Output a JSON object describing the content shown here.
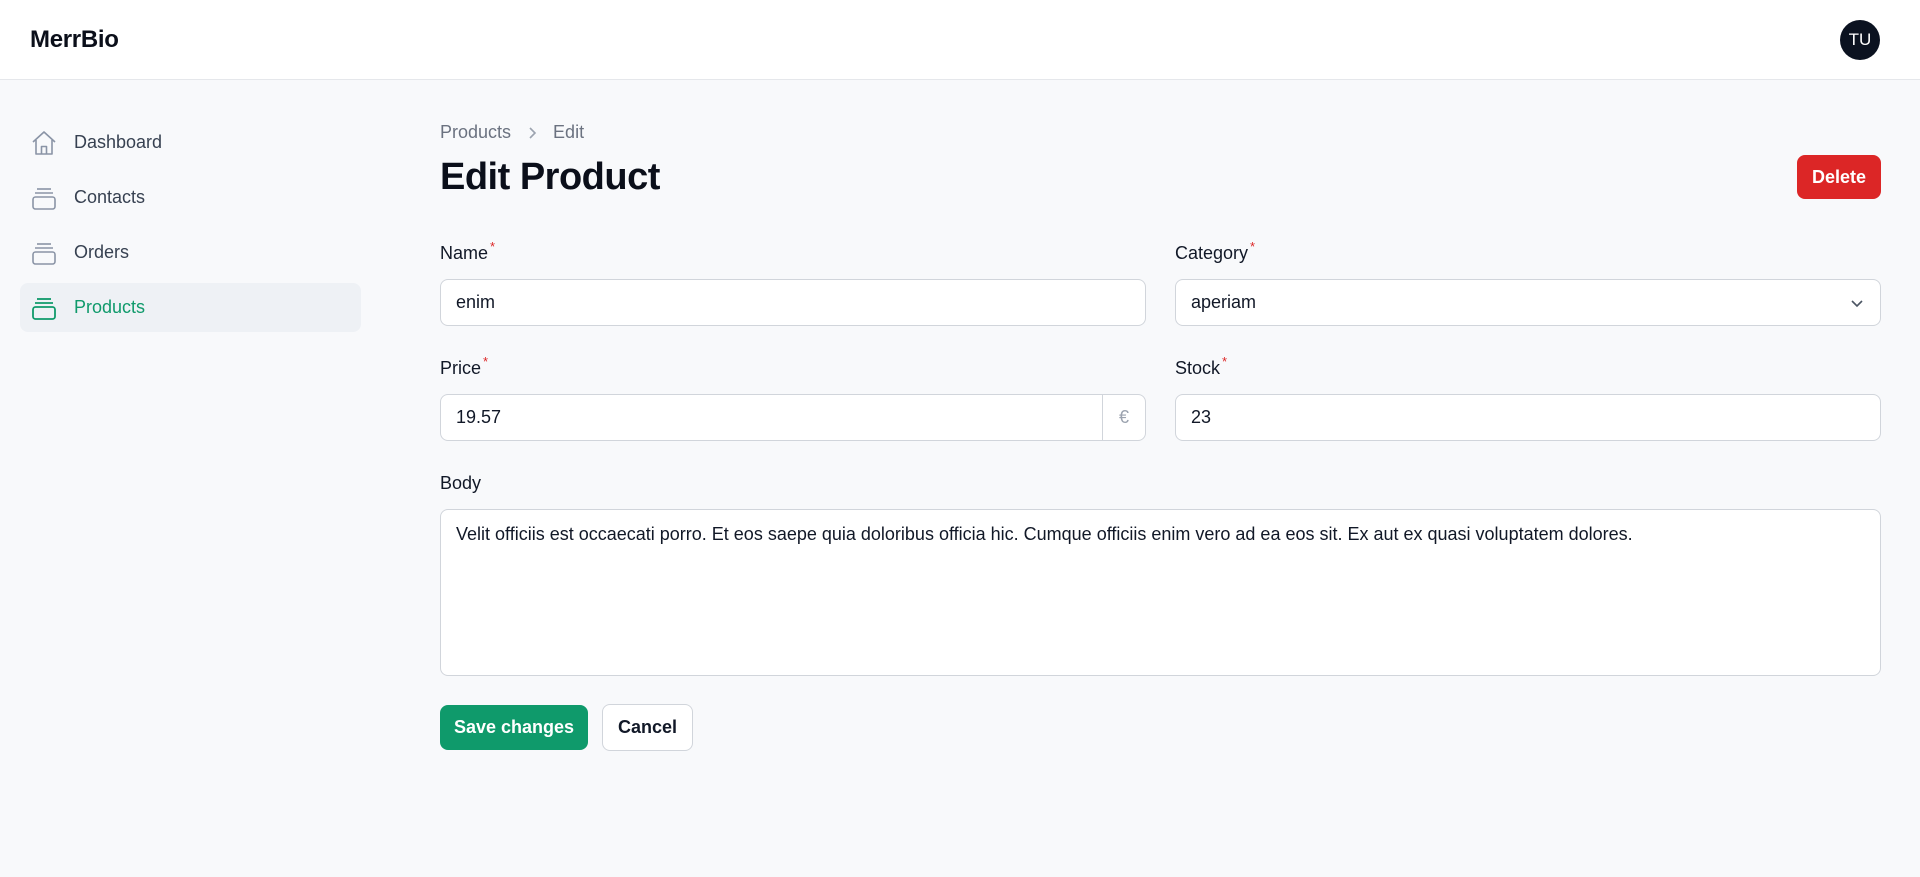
{
  "app": {
    "brand": "MerrBio",
    "user_initials": "TU"
  },
  "sidebar": {
    "items": [
      {
        "label": "Dashboard",
        "icon": "home-icon",
        "active": false
      },
      {
        "label": "Contacts",
        "icon": "box-icon",
        "active": false
      },
      {
        "label": "Orders",
        "icon": "box-icon",
        "active": false
      },
      {
        "label": "Products",
        "icon": "box-icon",
        "active": true
      }
    ]
  },
  "breadcrumb": {
    "parent": "Products",
    "current": "Edit"
  },
  "page": {
    "title": "Edit Product",
    "delete_label": "Delete"
  },
  "form": {
    "name": {
      "label": "Name",
      "required": "*",
      "value": "enim"
    },
    "category": {
      "label": "Category",
      "required": "*",
      "value": "aperiam"
    },
    "price": {
      "label": "Price",
      "required": "*",
      "value": "19.57",
      "suffix": "€"
    },
    "stock": {
      "label": "Stock",
      "required": "*",
      "value": "23"
    },
    "body": {
      "label": "Body",
      "value": "Velit officiis est occaecati porro. Et eos saepe quia doloribus officia hic. Cumque officiis enim vero ad ea eos sit. Ex aut ex quasi voluptatem dolores."
    },
    "save_label": "Save changes",
    "cancel_label": "Cancel"
  },
  "colors": {
    "accent": "#0f9a6b",
    "danger": "#dc2626",
    "background": "#f8f9fb",
    "avatar": "#0b1220"
  }
}
